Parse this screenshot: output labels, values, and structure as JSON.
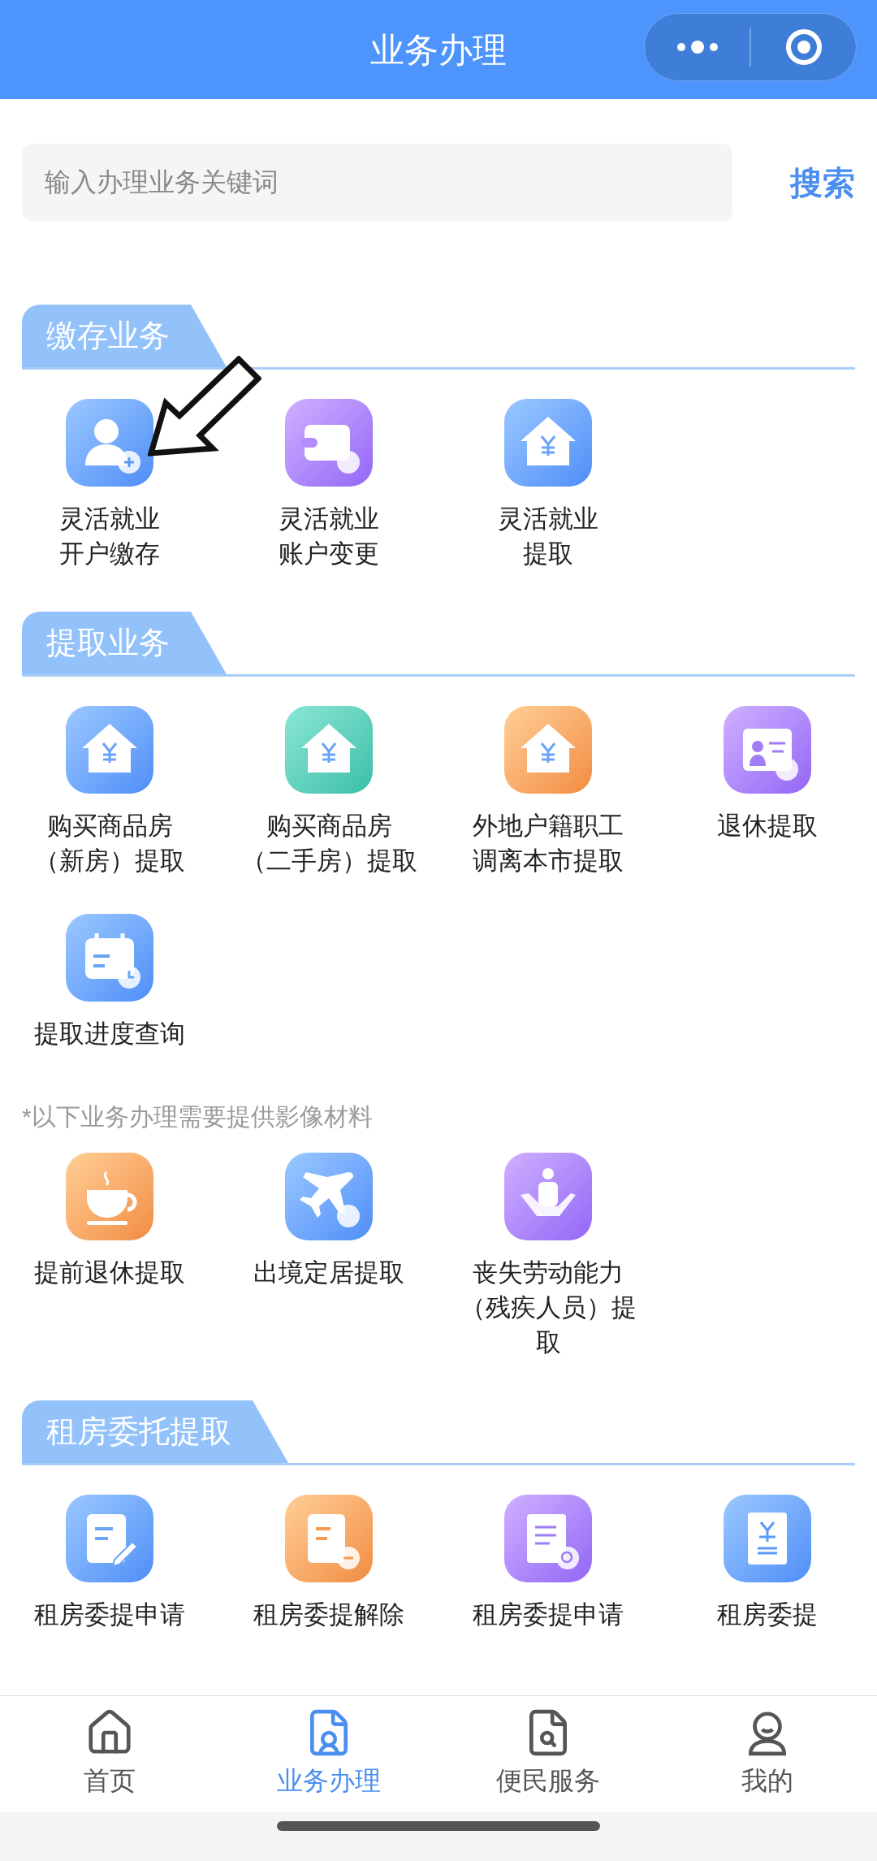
{
  "header": {
    "title": "业务办理"
  },
  "search": {
    "placeholder": "输入办理业务关键词",
    "button": "搜索"
  },
  "sections": [
    {
      "title": "缴存业务",
      "blocks": [
        {
          "kind": "grid",
          "items": [
            {
              "lines": [
                "灵活就业",
                "开户缴存"
              ]
            },
            {
              "lines": [
                "灵活就业",
                "账户变更"
              ]
            },
            {
              "lines": [
                "灵活就业",
                "提取"
              ]
            }
          ]
        }
      ]
    },
    {
      "title": "提取业务",
      "blocks": [
        {
          "kind": "grid",
          "items": [
            {
              "lines": [
                "购买商品房",
                "（新房）提取"
              ]
            },
            {
              "lines": [
                "购买商品房",
                "（二手房）提取"
              ]
            },
            {
              "lines": [
                "外地户籍职工",
                "调离本市提取"
              ]
            },
            {
              "lines": [
                "退休提取"
              ]
            },
            {
              "lines": [
                "提取进度查询"
              ]
            }
          ]
        },
        {
          "kind": "note",
          "text": "*以下业务办理需要提供影像材料"
        },
        {
          "kind": "grid",
          "items": [
            {
              "lines": [
                "提前退休提取"
              ]
            },
            {
              "lines": [
                "出境定居提取"
              ]
            },
            {
              "lines": [
                "丧失劳动能力",
                "（残疾人员）提",
                "取"
              ]
            }
          ]
        }
      ]
    },
    {
      "title": "租房委托提取",
      "blocks": [
        {
          "kind": "grid",
          "items": [
            {
              "lines": [
                "租房委提申请"
              ]
            },
            {
              "lines": [
                "租房委提解除"
              ]
            },
            {
              "lines": [
                "租房委提申请"
              ]
            },
            {
              "lines": [
                "租房委提"
              ]
            }
          ]
        }
      ]
    }
  ],
  "tabbar": [
    {
      "label": "首页",
      "selected": false
    },
    {
      "label": "业务办理",
      "selected": true
    },
    {
      "label": "便民服务",
      "selected": false
    },
    {
      "label": "我的",
      "selected": false
    }
  ]
}
